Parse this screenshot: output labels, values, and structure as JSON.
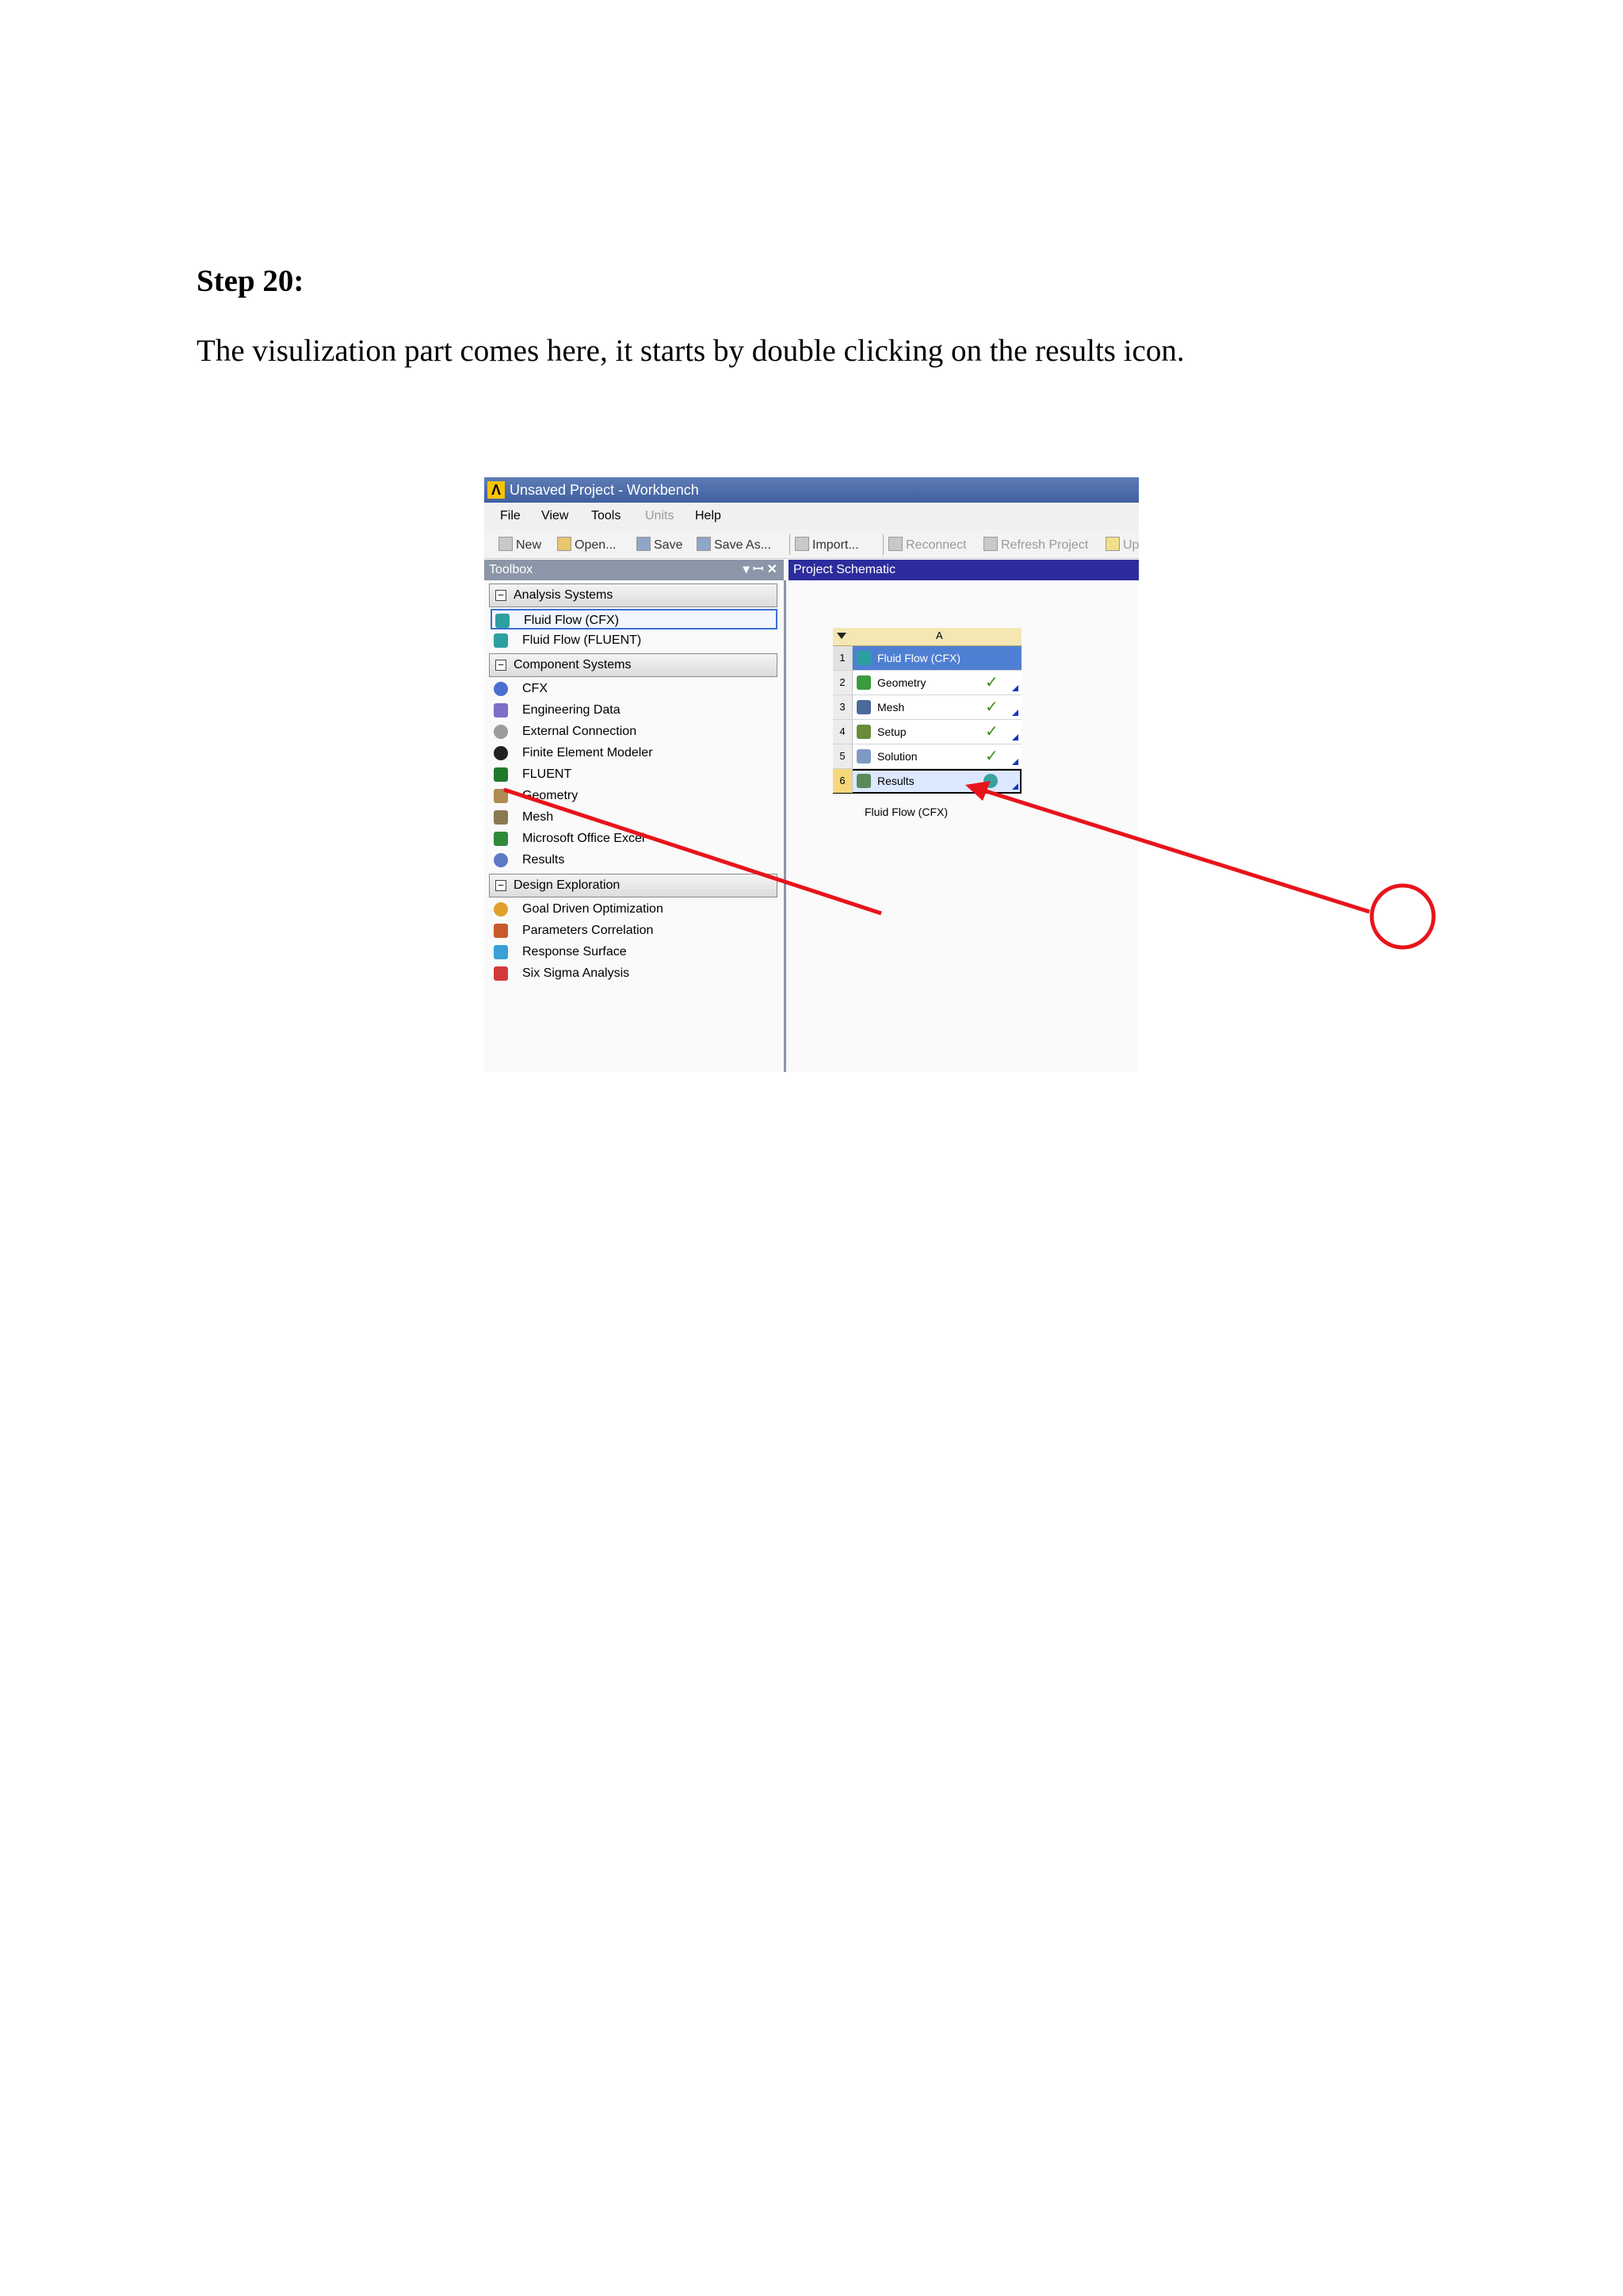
{
  "document": {
    "heading": "Step 20:",
    "body": "The visulization part comes here, it starts by double clicking on the results icon."
  },
  "window": {
    "title": "Unsaved Project - Workbench",
    "menu": [
      "File",
      "View",
      "Tools",
      "Units",
      "Help"
    ],
    "toolbar": {
      "new": "New",
      "open": "Open...",
      "save": "Save",
      "save_as": "Save As...",
      "import": "Import...",
      "reconnect": "Reconnect",
      "refresh_project": "Refresh Project",
      "update": "Up"
    }
  },
  "toolbox": {
    "title": "Toolbox",
    "controls": "▾ ꟷ ✕",
    "groups": [
      {
        "label": "Analysis Systems",
        "items": [
          "Fluid Flow (CFX)",
          "Fluid Flow (FLUENT)"
        ]
      },
      {
        "label": "Component Systems",
        "items": [
          "CFX",
          "Engineering Data",
          "External Connection",
          "Finite Element Modeler",
          "FLUENT",
          "Geometry",
          "Mesh",
          "Microsoft Office Excel",
          "Results"
        ]
      },
      {
        "label": "Design Exploration",
        "items": [
          "Goal Driven Optimization",
          "Parameters Correlation",
          "Response Surface",
          "Six Sigma Analysis"
        ]
      }
    ]
  },
  "schematic": {
    "title": "Project Schematic",
    "column": "A",
    "rows": [
      {
        "num": "1",
        "label": "Fluid Flow (CFX)"
      },
      {
        "num": "2",
        "label": "Geometry"
      },
      {
        "num": "3",
        "label": "Mesh"
      },
      {
        "num": "4",
        "label": "Setup"
      },
      {
        "num": "5",
        "label": "Solution"
      },
      {
        "num": "6",
        "label": "Results"
      }
    ],
    "caption": "Fluid Flow (CFX)",
    "check": "✓"
  },
  "colors": {
    "annotation": "#e8141b",
    "title_bar": "#4a6aaa",
    "schematic_header": "#2c2c9e"
  },
  "icons": {
    "annotation": "red-arrow-and-circle"
  }
}
